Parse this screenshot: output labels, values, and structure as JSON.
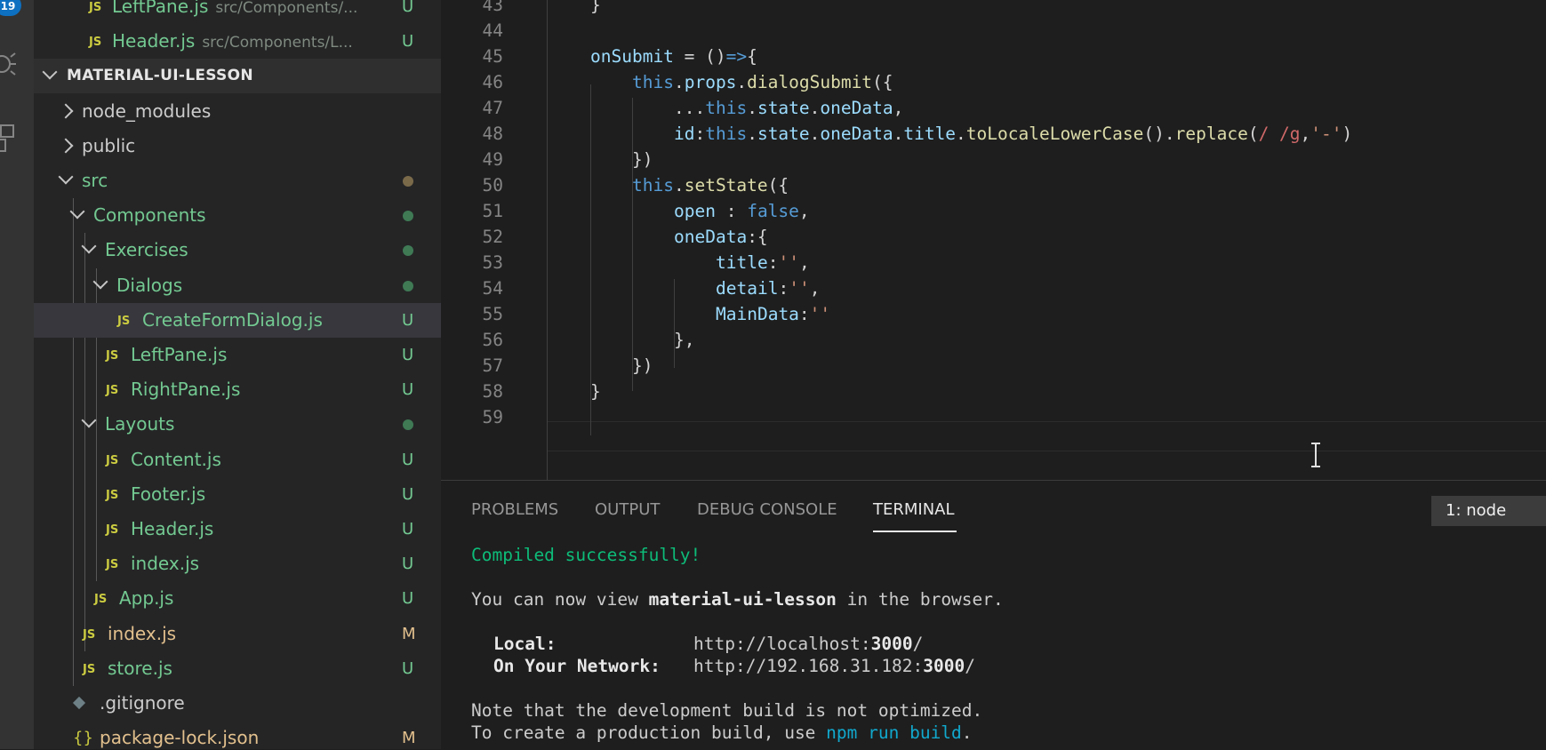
{
  "activity_bar": {
    "badge": "19",
    "icons": [
      "debug-icon",
      "extensions-icon"
    ]
  },
  "explorer": {
    "top_files": [
      {
        "name": "LeftPane.js",
        "path": "src/Components/...",
        "status": "U"
      },
      {
        "name": "Header.js",
        "path": "src/Components/L...",
        "status": "U"
      }
    ],
    "section_title": "MATERIAL-UI-LESSON",
    "tree": [
      {
        "name": "node_modules",
        "kind": "folder",
        "expanded": false,
        "depth": 0,
        "status": ""
      },
      {
        "name": "public",
        "kind": "folder",
        "expanded": false,
        "depth": 0,
        "status": ""
      },
      {
        "name": "src",
        "kind": "folder",
        "expanded": true,
        "depth": 0,
        "status": "dot"
      },
      {
        "name": "Components",
        "kind": "folder",
        "expanded": true,
        "depth": 1,
        "status": "dot"
      },
      {
        "name": "Exercises",
        "kind": "folder",
        "expanded": true,
        "depth": 2,
        "status": "dot"
      },
      {
        "name": "Dialogs",
        "kind": "folder",
        "expanded": true,
        "depth": 3,
        "status": "dot"
      },
      {
        "name": "CreateFormDialog.js",
        "kind": "js",
        "depth": 4,
        "status": "U",
        "selected": true
      },
      {
        "name": "LeftPane.js",
        "kind": "js",
        "depth": 3,
        "status": "U"
      },
      {
        "name": "RightPane.js",
        "kind": "js",
        "depth": 3,
        "status": "U"
      },
      {
        "name": "Layouts",
        "kind": "folder",
        "expanded": true,
        "depth": 2,
        "status": "dot"
      },
      {
        "name": "Content.js",
        "kind": "js",
        "depth": 3,
        "status": "U"
      },
      {
        "name": "Footer.js",
        "kind": "js",
        "depth": 3,
        "status": "U"
      },
      {
        "name": "Header.js",
        "kind": "js",
        "depth": 3,
        "status": "U"
      },
      {
        "name": "index.js",
        "kind": "js",
        "depth": 3,
        "status": "U"
      },
      {
        "name": "App.js",
        "kind": "js",
        "depth": 2,
        "status": "U"
      },
      {
        "name": "index.js",
        "kind": "js",
        "depth": 1,
        "status": "M"
      },
      {
        "name": "store.js",
        "kind": "js",
        "depth": 1,
        "status": "U"
      },
      {
        "name": ".gitignore",
        "kind": "gitignore",
        "depth": 0,
        "status": ""
      },
      {
        "name": "package-lock.json",
        "kind": "json",
        "depth": 0,
        "status": "M"
      }
    ]
  },
  "editor": {
    "lines": [
      {
        "num": "43",
        "indent": 0,
        "tokens": [
          [
            "p",
            "}"
          ]
        ]
      },
      {
        "num": "44",
        "indent": 0,
        "tokens": []
      },
      {
        "num": "45",
        "indent": 0,
        "tokens": [
          [
            "v",
            "onSubmit"
          ],
          [
            "p",
            " = ()"
          ],
          [
            "a",
            "=>"
          ],
          [
            "p",
            "{"
          ]
        ]
      },
      {
        "num": "46",
        "indent": 1,
        "tokens": [
          [
            "t",
            "this"
          ],
          [
            "p",
            "."
          ],
          [
            "v",
            "props"
          ],
          [
            "p",
            "."
          ],
          [
            "f",
            "dialogSubmit"
          ],
          [
            "p",
            "({"
          ]
        ]
      },
      {
        "num": "47",
        "indent": 2,
        "tokens": [
          [
            "p",
            "..."
          ],
          [
            "t",
            "this"
          ],
          [
            "p",
            "."
          ],
          [
            "v",
            "state"
          ],
          [
            "p",
            "."
          ],
          [
            "v",
            "oneData"
          ],
          [
            "p",
            ","
          ]
        ]
      },
      {
        "num": "48",
        "indent": 2,
        "tokens": [
          [
            "v",
            "id"
          ],
          [
            "p",
            ":"
          ],
          [
            "t",
            "this"
          ],
          [
            "p",
            "."
          ],
          [
            "v",
            "state"
          ],
          [
            "p",
            "."
          ],
          [
            "v",
            "oneData"
          ],
          [
            "p",
            "."
          ],
          [
            "v",
            "title"
          ],
          [
            "p",
            "."
          ],
          [
            "f",
            "toLocaleLowerCase"
          ],
          [
            "p",
            "()."
          ],
          [
            "f",
            "replace"
          ],
          [
            "p",
            "("
          ],
          [
            "r",
            "/ /g"
          ],
          [
            "p",
            ","
          ],
          [
            "s",
            "'-'"
          ],
          [
            "p",
            ")"
          ]
        ]
      },
      {
        "num": "49",
        "indent": 1,
        "tokens": [
          [
            "p",
            "})"
          ]
        ]
      },
      {
        "num": "50",
        "indent": 1,
        "tokens": [
          [
            "t",
            "this"
          ],
          [
            "p",
            "."
          ],
          [
            "f",
            "setState"
          ],
          [
            "p",
            "({"
          ]
        ]
      },
      {
        "num": "51",
        "indent": 2,
        "tokens": [
          [
            "v",
            "open"
          ],
          [
            "p",
            " : "
          ],
          [
            "t",
            "false"
          ],
          [
            "p",
            ","
          ]
        ]
      },
      {
        "num": "52",
        "indent": 2,
        "tokens": [
          [
            "v",
            "oneData"
          ],
          [
            "p",
            ":{"
          ]
        ]
      },
      {
        "num": "53",
        "indent": 3,
        "tokens": [
          [
            "v",
            "title"
          ],
          [
            "p",
            ":"
          ],
          [
            "s",
            "''"
          ],
          [
            "p",
            ","
          ]
        ]
      },
      {
        "num": "54",
        "indent": 3,
        "tokens": [
          [
            "v",
            "detail"
          ],
          [
            "p",
            ":"
          ],
          [
            "s",
            "''"
          ],
          [
            "p",
            ","
          ]
        ]
      },
      {
        "num": "55",
        "indent": 3,
        "tokens": [
          [
            "v",
            "MainData"
          ],
          [
            "p",
            ":"
          ],
          [
            "s",
            "''"
          ]
        ]
      },
      {
        "num": "56",
        "indent": 2,
        "tokens": [
          [
            "p",
            "},"
          ]
        ]
      },
      {
        "num": "57",
        "indent": 1,
        "tokens": [
          [
            "p",
            "})"
          ]
        ]
      },
      {
        "num": "58",
        "indent": 0,
        "tokens": [
          [
            "p",
            "}"
          ]
        ]
      },
      {
        "num": "59",
        "indent": 0,
        "tokens": []
      }
    ]
  },
  "panel": {
    "tabs": [
      {
        "label": "PROBLEMS",
        "active": false
      },
      {
        "label": "OUTPUT",
        "active": false
      },
      {
        "label": "DEBUG CONSOLE",
        "active": false
      },
      {
        "label": "TERMINAL",
        "active": true
      }
    ],
    "terminal_select": "1: node",
    "terminal": {
      "compiled": "Compiled successfully!",
      "view_prefix": "You can now view ",
      "app_name": "material-ui-lesson",
      "view_suffix": " in the browser.",
      "local_label": "Local:",
      "local_url_prefix": "http://localhost:",
      "local_port": "3000",
      "local_url_suffix": "/",
      "network_label": "On Your Network:",
      "network_url_prefix": "http://192.168.31.182:",
      "network_port": "3000",
      "network_url_suffix": "/",
      "note": "Note that the development build is not optimized.",
      "prod_prefix": "To create a production build, use ",
      "prod_cmd": "npm run build",
      "prod_suffix": "."
    }
  }
}
